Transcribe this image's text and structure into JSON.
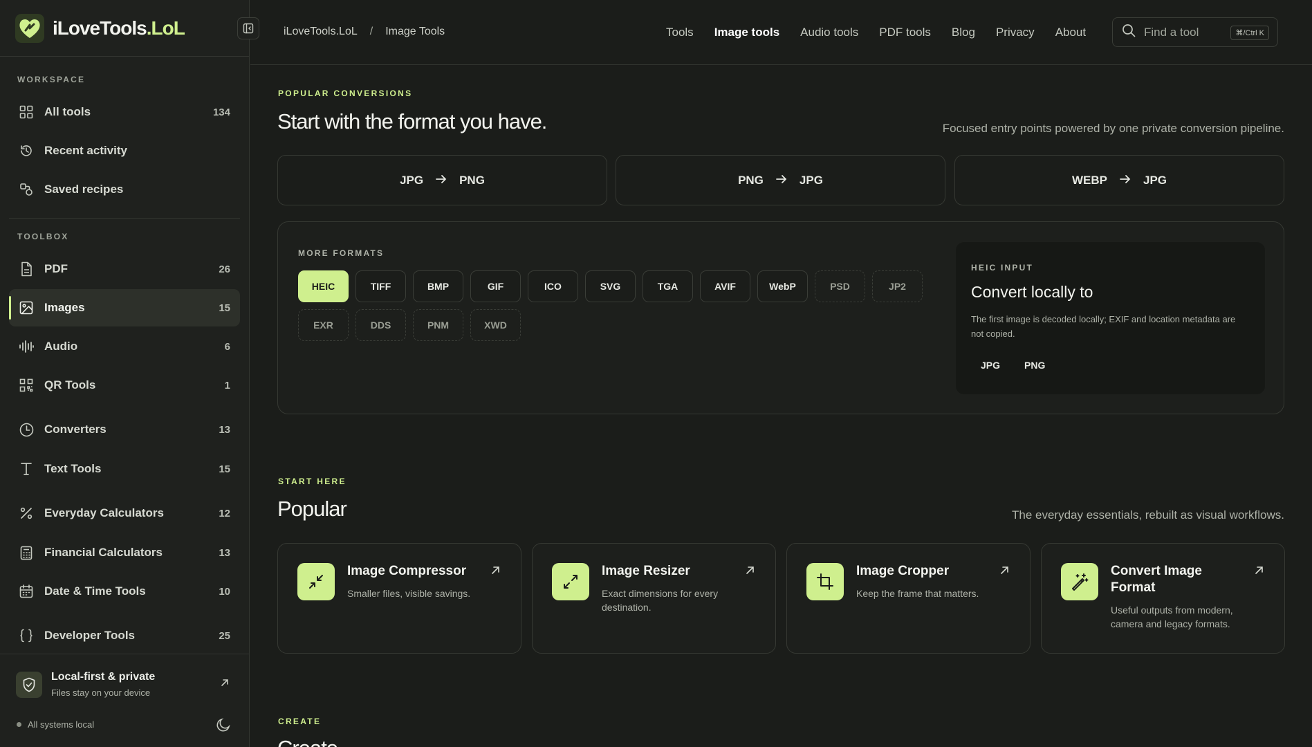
{
  "brand": {
    "name_main": "iLoveTools",
    "name_accent": ".LoL"
  },
  "sidebar": {
    "workspace_label": "WORKSPACE",
    "workspace": [
      {
        "label": "All tools",
        "count": "134",
        "icon": "grid-icon"
      },
      {
        "label": "Recent activity",
        "count": "",
        "icon": "history-icon"
      },
      {
        "label": "Saved recipes",
        "count": "",
        "icon": "recipes-icon"
      }
    ],
    "toolbox_label": "TOOLBOX",
    "toolbox": [
      {
        "label": "PDF",
        "count": "26",
        "icon": "document-icon"
      },
      {
        "label": "Images",
        "count": "15",
        "icon": "image-icon",
        "active": true
      },
      {
        "label": "Audio",
        "count": "6",
        "icon": "audio-wave-icon"
      },
      {
        "label": "QR Tools",
        "count": "1",
        "icon": "qr-icon"
      },
      {
        "label": "Converters",
        "count": "13",
        "icon": "clock-icon"
      },
      {
        "label": "Text Tools",
        "count": "15",
        "icon": "text-icon"
      },
      {
        "label": "Everyday Calculators",
        "count": "12",
        "icon": "percent-icon"
      },
      {
        "label": "Financial Calculators",
        "count": "13",
        "icon": "calculator-icon"
      },
      {
        "label": "Date & Time Tools",
        "count": "10",
        "icon": "calendar-icon"
      },
      {
        "label": "Developer Tools",
        "count": "25",
        "icon": "braces-icon"
      }
    ],
    "footer": {
      "title": "Local-first & private",
      "subtitle": "Files stay on your device",
      "status": "All systems local"
    }
  },
  "topbar": {
    "breadcrumb": [
      "iLoveTools.LoL",
      "/",
      "Image Tools"
    ],
    "nav": [
      "Tools",
      "Image tools",
      "Audio tools",
      "PDF tools",
      "Blog",
      "Privacy",
      "About"
    ],
    "active_nav": "Image tools",
    "search": {
      "placeholder": "Find a tool",
      "shortcut": "⌘/Ctrl K"
    }
  },
  "popular_conversions": {
    "kicker": "POPULAR CONVERSIONS",
    "title": "Start with the format you have.",
    "subtitle": "Focused entry points powered by one private conversion pipeline.",
    "items": [
      {
        "from": "JPG",
        "to": "PNG"
      },
      {
        "from": "PNG",
        "to": "JPG"
      },
      {
        "from": "WEBP",
        "to": "JPG"
      }
    ]
  },
  "more_formats": {
    "label": "MORE FORMATS",
    "formats": [
      {
        "name": "HEIC",
        "state": "selected"
      },
      {
        "name": "TIFF",
        "state": "normal"
      },
      {
        "name": "BMP",
        "state": "normal"
      },
      {
        "name": "GIF",
        "state": "normal"
      },
      {
        "name": "ICO",
        "state": "normal"
      },
      {
        "name": "SVG",
        "state": "normal"
      },
      {
        "name": "TGA",
        "state": "normal"
      },
      {
        "name": "AVIF",
        "state": "normal"
      },
      {
        "name": "WebP",
        "state": "normal"
      },
      {
        "name": "PSD",
        "state": "dim"
      },
      {
        "name": "JP2",
        "state": "dim"
      },
      {
        "name": "EXR",
        "state": "dim"
      },
      {
        "name": "DDS",
        "state": "dim"
      },
      {
        "name": "PNM",
        "state": "dim"
      },
      {
        "name": "XWD",
        "state": "dim"
      }
    ],
    "detail": {
      "kicker": "HEIC INPUT",
      "title": "Convert locally to",
      "description": "The first image is decoded locally; EXIF and location metadata are not copied.",
      "outputs": [
        "JPG",
        "PNG"
      ]
    }
  },
  "start_here": {
    "kicker": "START HERE",
    "title": "Popular",
    "subtitle": "The everyday essentials, rebuilt as visual workflows.",
    "cards": [
      {
        "title": "Image Compressor",
        "desc": "Smaller files, visible savings.",
        "icon": "compress-icon"
      },
      {
        "title": "Image Resizer",
        "desc": "Exact dimensions for every destination.",
        "icon": "expand-icon"
      },
      {
        "title": "Image Cropper",
        "desc": "Keep the frame that matters.",
        "icon": "crop-icon"
      },
      {
        "title": "Convert Image Format",
        "desc": "Useful outputs from modern, camera and legacy formats.",
        "icon": "magic-wand-icon"
      }
    ]
  },
  "create": {
    "kicker": "CREATE",
    "title": "Create"
  },
  "colors": {
    "accent": "#cfef8e",
    "background": "#1b1d1a",
    "sidebar": "#1f211e"
  }
}
